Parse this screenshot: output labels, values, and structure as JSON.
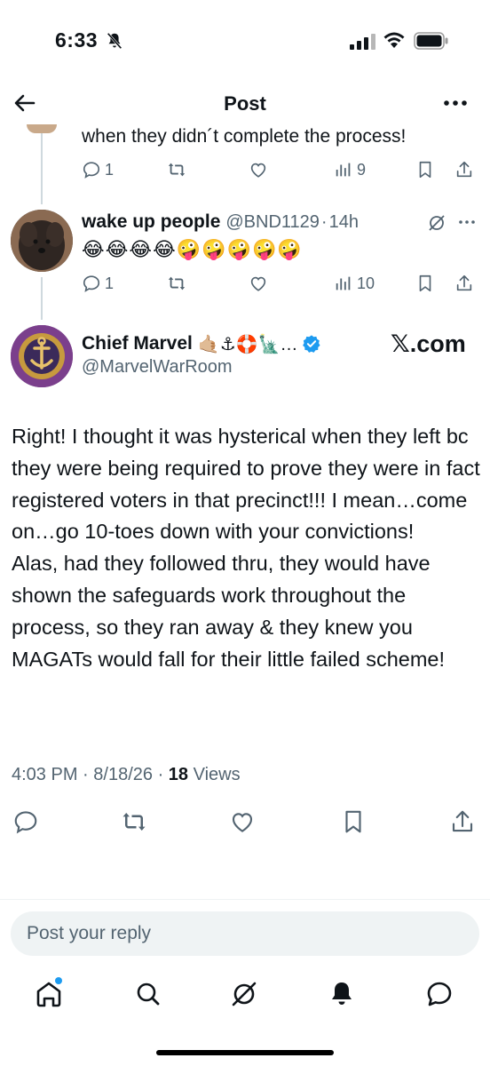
{
  "status_bar": {
    "time": "6:33"
  },
  "nav": {
    "title": "Post"
  },
  "previous_reply": {
    "text": "when they didn´t complete the process!",
    "replies": "1",
    "views": "9"
  },
  "reply": {
    "name": "wake up people",
    "handle": "@BND1129",
    "sep": "·",
    "time": "14h",
    "emoji": "😂😂😂😂🤪🤪🤪🤪🤪",
    "replies": "1",
    "views": "10"
  },
  "main_post": {
    "name": "Chief Marvel",
    "name_emoji": "🤙🏼⚓🛟🗽…",
    "handle": "@MarvelWarRoom",
    "watermark": "𝕏.com",
    "body": "Right! I thought it was hysterical when they left bc they were being required to prove they were in fact registered voters in that precinct!!! I mean…come on…go 10-toes down with your convictions!\nAlas, had they followed thru, they would have shown the safeguards work throughout the process, so they ran away & they knew you MAGATs would fall for their little failed scheme!",
    "time": "4:03 PM",
    "date": "8/18/26",
    "views_count": "18",
    "views_label": "Views"
  },
  "reply_box": {
    "placeholder": "Post your reply"
  },
  "colors": {
    "accent": "#1d9bf0",
    "text": "#0f1419",
    "muted": "#536471"
  }
}
